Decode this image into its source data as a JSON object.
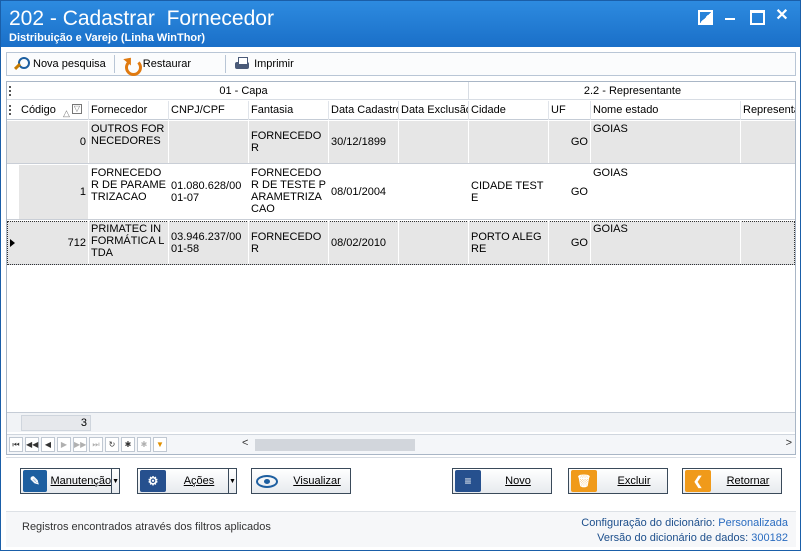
{
  "window": {
    "title": "202 - Cadastrar  Fornecedor",
    "subtitle": "Distribuição e Varejo (Linha WinThor)",
    "close_glyph": "✕"
  },
  "toolbar": {
    "nova_pesquisa": "Nova pesquisa",
    "restaurar": "Restaurar",
    "imprimir": "Imprimir"
  },
  "grid": {
    "groups": [
      "01 - Capa",
      "2.2 - Representante"
    ],
    "columns": [
      "Código",
      "Fornecedor",
      "CNPJ/CPF",
      "Fantasia",
      "Data Cadastro",
      "Data Exclusão",
      "Cidade",
      "UF",
      "Nome estado",
      "Representante"
    ],
    "rows": [
      {
        "codigo": "0",
        "fornecedor": "OUTROS FORNECEDORES",
        "cnpj": "",
        "fantasia": "FORNECEDOR",
        "data_cadastro": "30/12/1899",
        "data_exclusao": "",
        "cidade": "",
        "uf": "GO",
        "nome_estado": "GOIAS",
        "representante": ""
      },
      {
        "codigo": "1",
        "fornecedor": "FORNECEDOR DE PARAMETRIZACAO",
        "cnpj": "01.080.628/0001-07",
        "fantasia": "FORNECEDOR DE TESTE PARAMETRIZACAO",
        "data_cadastro": "08/01/2004",
        "data_exclusao": "",
        "cidade": "CIDADE TESTE",
        "uf": "GO",
        "nome_estado": "GOIAS",
        "representante": ""
      },
      {
        "codigo": "712",
        "fornecedor": "PRIMATEC INFORMÁTICA LTDA",
        "cnpj": "03.946.237/0001-58",
        "fantasia": "FORNECEDOR",
        "data_cadastro": "08/02/2010",
        "data_exclusao": "",
        "cidade": "PORTO ALEGRE",
        "uf": "GO",
        "nome_estado": "GOIAS",
        "representante": ""
      }
    ],
    "footer_count": "3"
  },
  "buttons": {
    "manutencao": "Manutenção",
    "acoes": "Ações",
    "visualizar": "Visualizar",
    "novo": "Novo",
    "excluir": "Excluir",
    "retornar": "Retornar"
  },
  "status": {
    "left": "Registros encontrados através dos filtros aplicados",
    "config_label": "Configuração do dicionário:",
    "config_value": "Personalizada",
    "versao_label": "Versão do dicionário de dados:",
    "versao_value": "300182"
  }
}
